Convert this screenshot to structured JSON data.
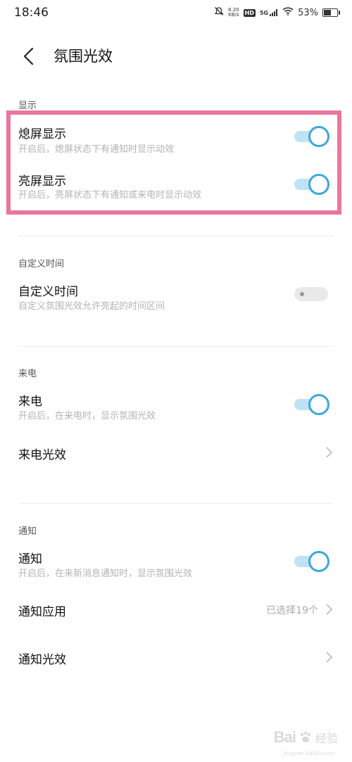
{
  "status_bar": {
    "time": "18:46",
    "net_speed_top": "8.20",
    "net_speed_bottom": "KB/s",
    "hd": "HD",
    "signal": "5G",
    "battery": "53%",
    "battery_level": 0.53
  },
  "header": {
    "title": "氛围光效"
  },
  "sections": {
    "display": {
      "label": "显示",
      "items": [
        {
          "title": "熄屏显示",
          "subtitle": "开启后，熄屏状态下有通知时显示动效",
          "on": true
        },
        {
          "title": "亮屏显示",
          "subtitle": "开启后，亮屏状态下有通知或来电时显示动效",
          "on": true
        }
      ]
    },
    "custom_time": {
      "label": "自定义时间",
      "item": {
        "title": "自定义时间",
        "subtitle": "自定义氛围光效允许亮起的时间区间",
        "on": false
      }
    },
    "call": {
      "label": "来电",
      "toggle_item": {
        "title": "来电",
        "subtitle": "开启后，在来电时，显示氛围光效",
        "on": true
      },
      "link_item": {
        "title": "来电光效"
      }
    },
    "notify": {
      "label": "通知",
      "toggle_item": {
        "title": "通知",
        "subtitle": "开启后，在来新消息通知时，显示氛围光效",
        "on": true
      },
      "apps_item": {
        "title": "通知应用",
        "value": "已选择19个"
      },
      "effect_item": {
        "title": "通知光效"
      }
    }
  },
  "watermark": {
    "logo": "Bai",
    "text": "经验",
    "url": "jingyan.baidu.com"
  },
  "colors": {
    "accent": "#3ca7dc",
    "highlight": "#e8769d"
  }
}
